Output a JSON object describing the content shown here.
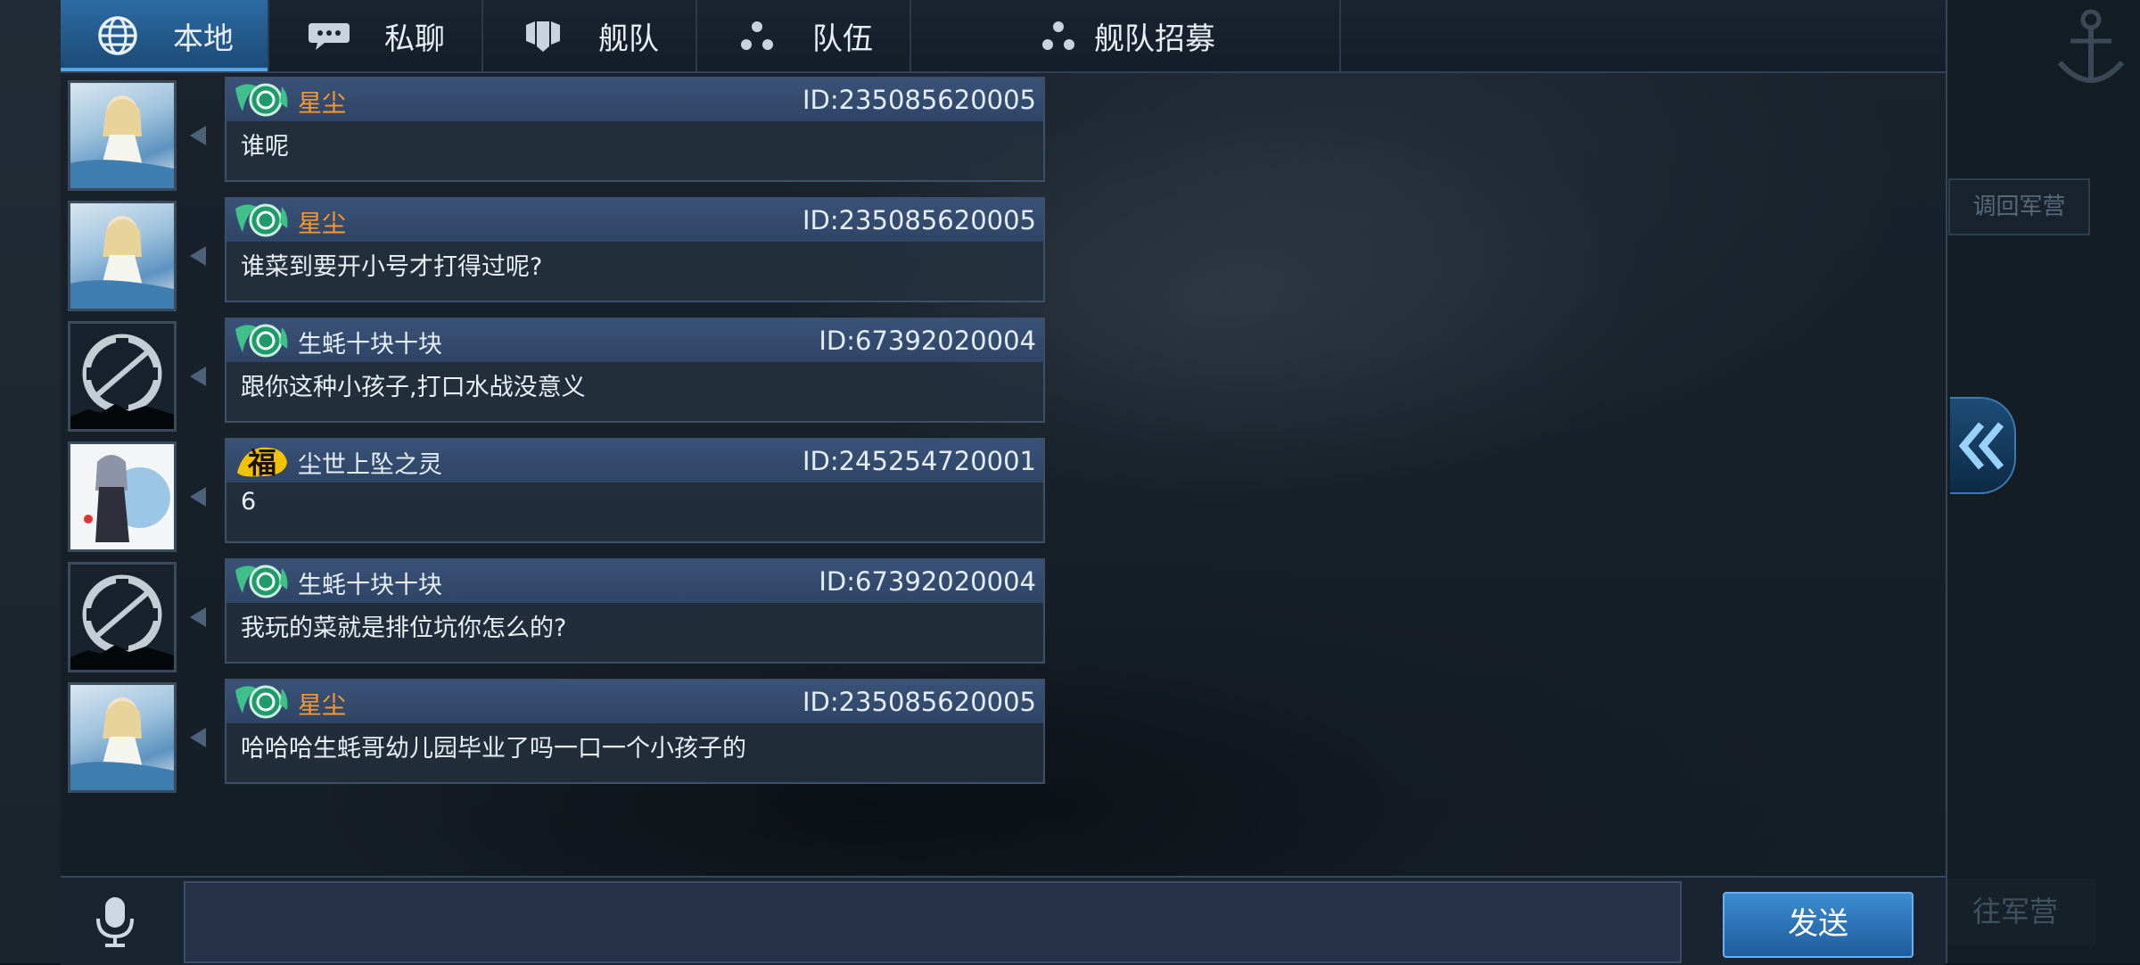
{
  "tabs": [
    {
      "label": "本地",
      "icon": "globe-icon",
      "active": true
    },
    {
      "label": "私聊",
      "icon": "chat-bubble-icon",
      "active": false
    },
    {
      "label": "舰队",
      "icon": "fleet-shield-icon",
      "active": false
    },
    {
      "label": "队伍",
      "icon": "team-dots-icon",
      "active": false
    },
    {
      "label": "舰队招募",
      "icon": "recruit-dots-icon",
      "active": false
    }
  ],
  "messages": [
    {
      "name": "星尘",
      "id": "ID:235085620005",
      "text": "谁呢",
      "avatar": "anime-girl-avatar",
      "badge": "green-rank-badge",
      "name_color": "#ff9a2a"
    },
    {
      "name": "星尘",
      "id": "ID:235085620005",
      "text": "谁菜到要开小号才打得过呢?",
      "avatar": "anime-girl-avatar",
      "badge": "green-rank-badge",
      "name_color": "#ff9a2a"
    },
    {
      "name": "生蚝十块十块",
      "id": "ID:67392020004",
      "text": "跟你这种小孩子,打口水战没意义",
      "avatar": "crosshair-emblem-avatar",
      "badge": "green-rank-badge",
      "name_color": "#e6eef7"
    },
    {
      "name": "尘世上坠之灵",
      "id": "ID:245254720001",
      "text": "6",
      "avatar": "character-portrait-avatar",
      "badge": "fu-badge",
      "name_color": "#e6eef7"
    },
    {
      "name": "生蚝十块十块",
      "id": "ID:67392020004",
      "text": "我玩的菜就是排位坑你怎么的?",
      "avatar": "crosshair-emblem-avatar",
      "badge": "green-rank-badge",
      "name_color": "#e6eef7"
    },
    {
      "name": "星尘",
      "id": "ID:235085620005",
      "text": "哈哈哈生蚝哥幼儿园毕业了吗一口一个小孩子的",
      "avatar": "anime-girl-avatar",
      "badge": "green-rank-badge",
      "name_color": "#ff9a2a"
    }
  ],
  "input": {
    "value": "",
    "placeholder": ""
  },
  "send_label": "发送",
  "side": {
    "recall_label": "调回军营",
    "goto_label": "往军营"
  },
  "badge_text": {
    "fu": "福"
  },
  "colors": {
    "accent": "#2d6ba2",
    "header": "#3a5277",
    "highlight_name": "#ff9a2a"
  }
}
